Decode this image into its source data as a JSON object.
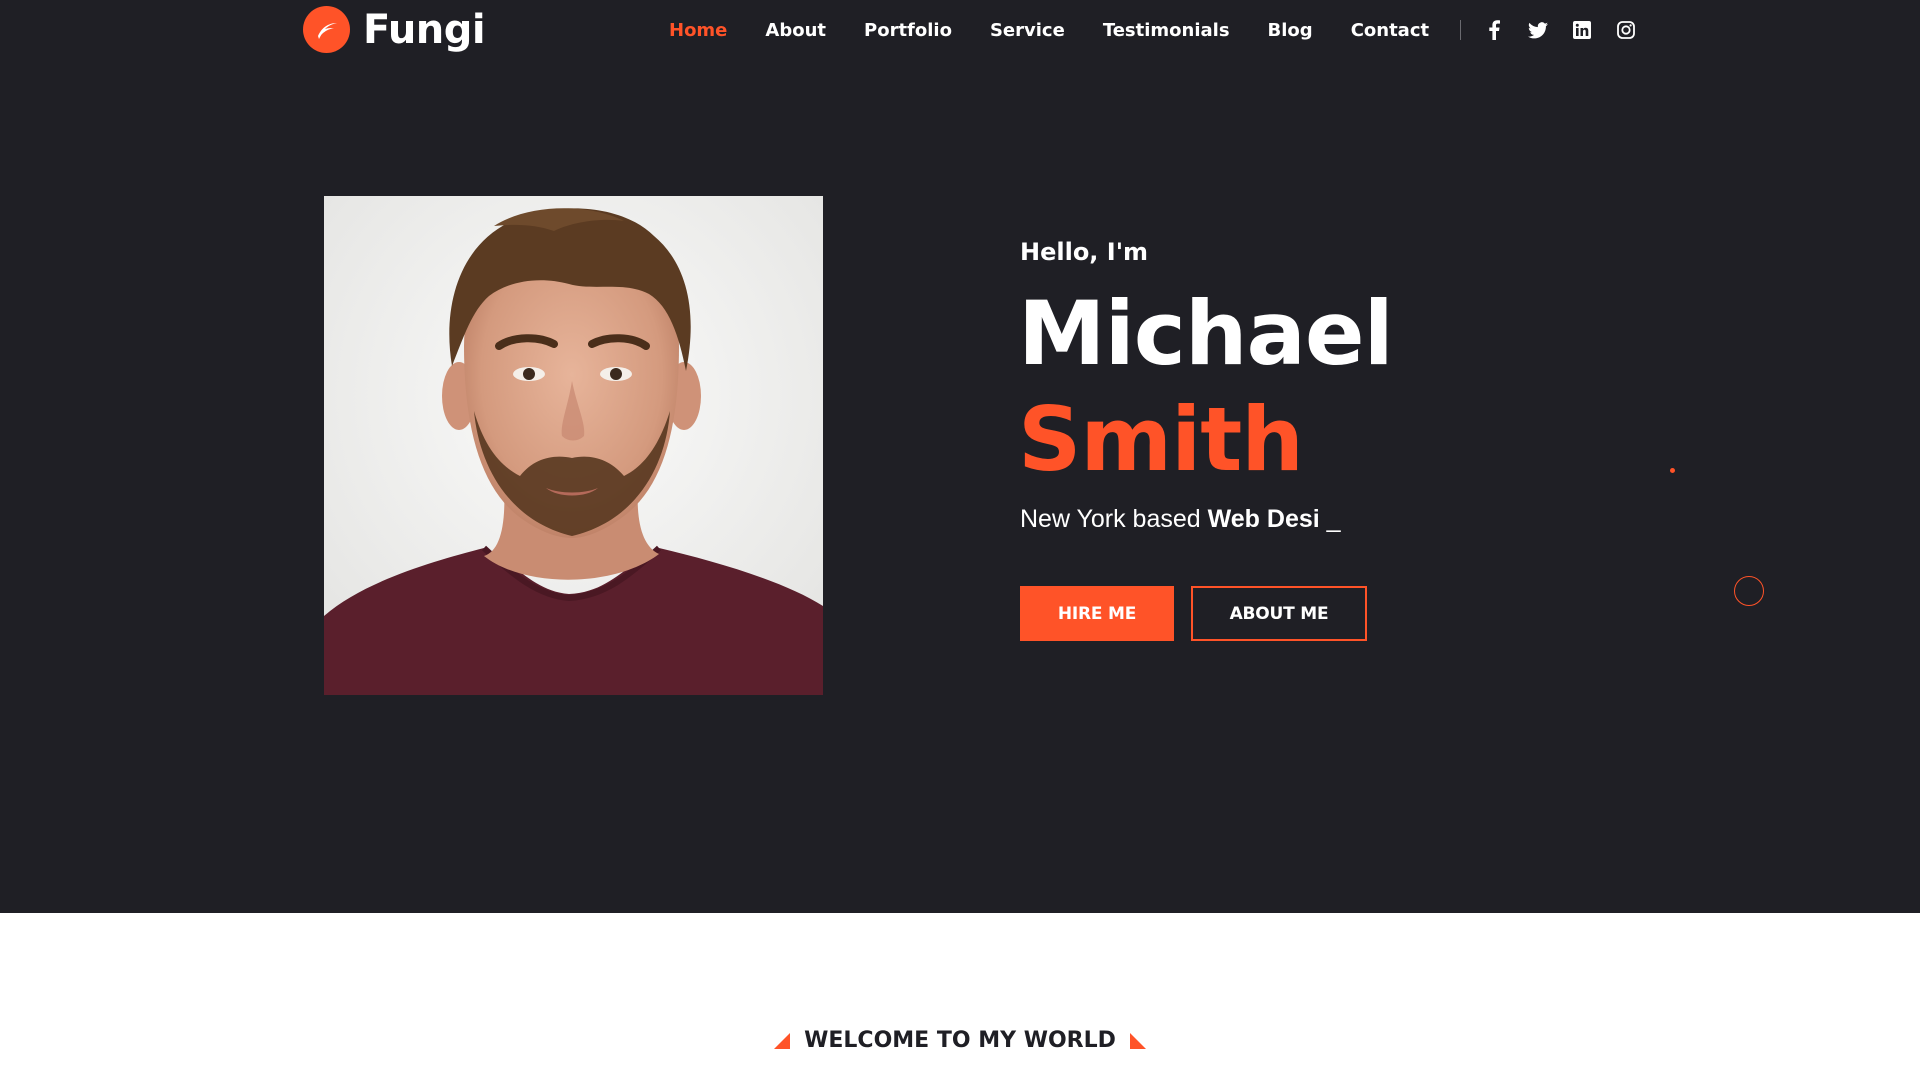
{
  "brand": {
    "name": "Fungi",
    "logo_icon": "feather-swoosh-icon",
    "accent_color": "#ff5328",
    "dark_bg": "#1f1f25"
  },
  "nav": {
    "items": [
      {
        "label": "Home",
        "active": true
      },
      {
        "label": "About",
        "active": false
      },
      {
        "label": "Portfolio",
        "active": false
      },
      {
        "label": "Service",
        "active": false
      },
      {
        "label": "Testimonials",
        "active": false
      },
      {
        "label": "Blog",
        "active": false
      },
      {
        "label": "Contact",
        "active": false
      }
    ],
    "social": [
      "facebook-icon",
      "twitter-icon",
      "linkedin-icon",
      "instagram-icon"
    ]
  },
  "hero": {
    "greeting": "Hello, I'm",
    "first_name": "Michael",
    "last_name": "Smith",
    "tagline_prefix": "New York based ",
    "tagline_role": "Web Desi",
    "tagline_cursor": " _",
    "hire_button": "HIRE ME",
    "about_button": "ABOUT ME",
    "portrait_icon": "portrait-photo"
  },
  "welcome": {
    "title": "WELCOME TO MY WORLD"
  }
}
